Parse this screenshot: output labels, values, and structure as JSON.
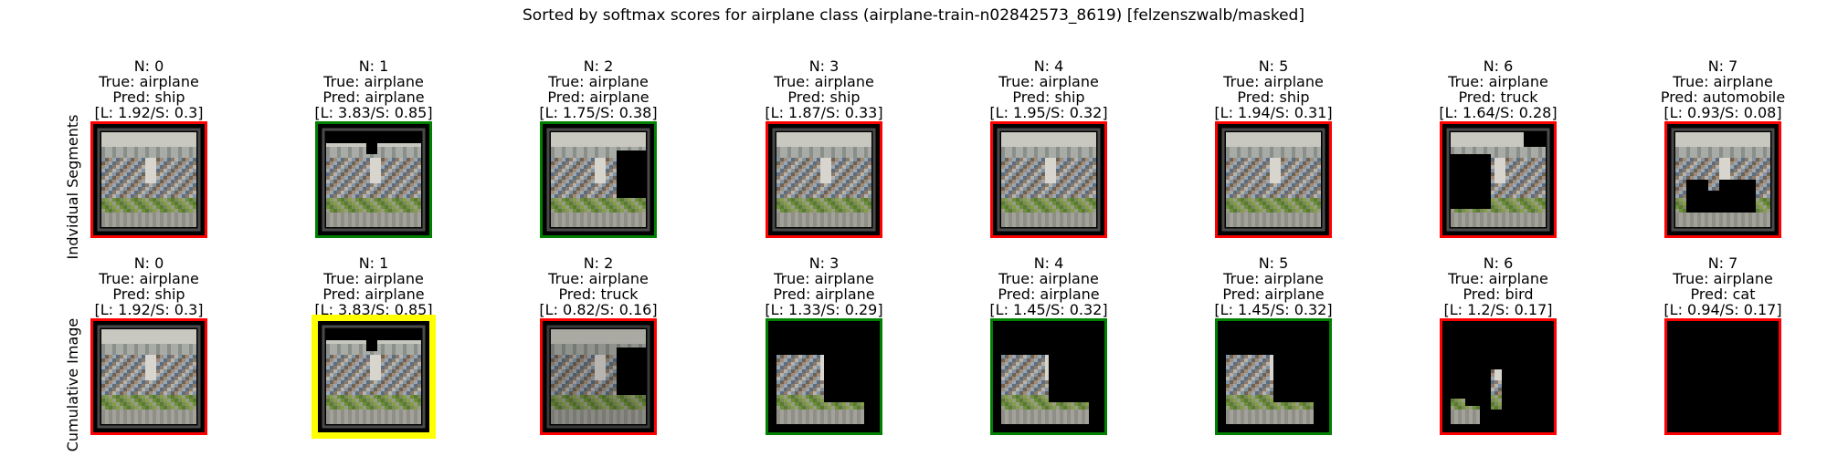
{
  "title": "Sorted by softmax scores for airplane class (airplane-train-n02842573_8619) [felzenszwalb/masked]",
  "row_labels": [
    "Indvidual Segments",
    "Cumulative Image"
  ],
  "colors": {
    "wrong": "#ff0000",
    "correct": "#008000",
    "best": "#ffff00"
  },
  "chart_data": {
    "type": "table",
    "title": "Sorted by softmax scores for airplane class (airplane-train-n02842573_8619) [felzenszwalb/masked]",
    "rows": [
      {
        "label": "Indvidual Segments",
        "panels": [
          {
            "n": "N: 0",
            "true": "True: airplane",
            "pred": "Pred: ship",
            "score": "[L: 1.92/S: 0.3]",
            "border": "wrong",
            "mask": "full"
          },
          {
            "n": "N: 1",
            "true": "True: airplane",
            "pred": "Pred: airplane",
            "score": "[L: 3.83/S: 0.85]",
            "border": "correct",
            "mask": "cut_top"
          },
          {
            "n": "N: 2",
            "true": "True: airplane",
            "pred": "Pred: airplane",
            "score": "[L: 1.75/S: 0.38]",
            "border": "correct",
            "mask": "cut_right"
          },
          {
            "n": "N: 3",
            "true": "True: airplane",
            "pred": "Pred: ship",
            "score": "[L: 1.87/S: 0.33]",
            "border": "wrong",
            "mask": "full"
          },
          {
            "n": "N: 4",
            "true": "True: airplane",
            "pred": "Pred: ship",
            "score": "[L: 1.95/S: 0.32]",
            "border": "wrong",
            "mask": "full"
          },
          {
            "n": "N: 5",
            "true": "True: airplane",
            "pred": "Pred: ship",
            "score": "[L: 1.94/S: 0.31]",
            "border": "wrong",
            "mask": "full"
          },
          {
            "n": "N: 6",
            "true": "True: airplane",
            "pred": "Pred: truck",
            "score": "[L: 1.64/S: 0.28]",
            "border": "wrong",
            "mask": "left_hole"
          },
          {
            "n": "N: 7",
            "true": "True: airplane",
            "pred": "Pred: automobile",
            "score": "[L: 0.93/S: 0.08]",
            "border": "wrong",
            "mask": "bottom_hole"
          }
        ]
      },
      {
        "label": "Cumulative Image",
        "panels": [
          {
            "n": "N: 0",
            "true": "True: airplane",
            "pred": "Pred: ship",
            "score": "[L: 1.92/S: 0.3]",
            "border": "wrong",
            "mask": "full"
          },
          {
            "n": "N: 1",
            "true": "True: airplane",
            "pred": "Pred: airplane",
            "score": "[L: 3.83/S: 0.85]",
            "border": "best",
            "mask": "cut_top"
          },
          {
            "n": "N: 2",
            "true": "True: airplane",
            "pred": "Pred: truck",
            "score": "[L: 0.82/S: 0.16]",
            "border": "wrong",
            "mask": "cut_right_dim"
          },
          {
            "n": "N: 3",
            "true": "True: airplane",
            "pred": "Pred: airplane",
            "score": "[L: 1.33/S: 0.29]",
            "border": "correct",
            "mask": "lower_left"
          },
          {
            "n": "N: 4",
            "true": "True: airplane",
            "pred": "Pred: airplane",
            "score": "[L: 1.45/S: 0.32]",
            "border": "correct",
            "mask": "lower_left"
          },
          {
            "n": "N: 5",
            "true": "True: airplane",
            "pred": "Pred: airplane",
            "score": "[L: 1.45/S: 0.32]",
            "border": "correct",
            "mask": "lower_left"
          },
          {
            "n": "N: 6",
            "true": "True: airplane",
            "pred": "Pred: bird",
            "score": "[L: 1.2/S: 0.17]",
            "border": "wrong",
            "mask": "small_patch"
          },
          {
            "n": "N: 7",
            "true": "True: airplane",
            "pred": "Pred: cat",
            "score": "[L: 0.94/S: 0.17]",
            "border": "wrong",
            "mask": "empty"
          }
        ]
      }
    ]
  }
}
